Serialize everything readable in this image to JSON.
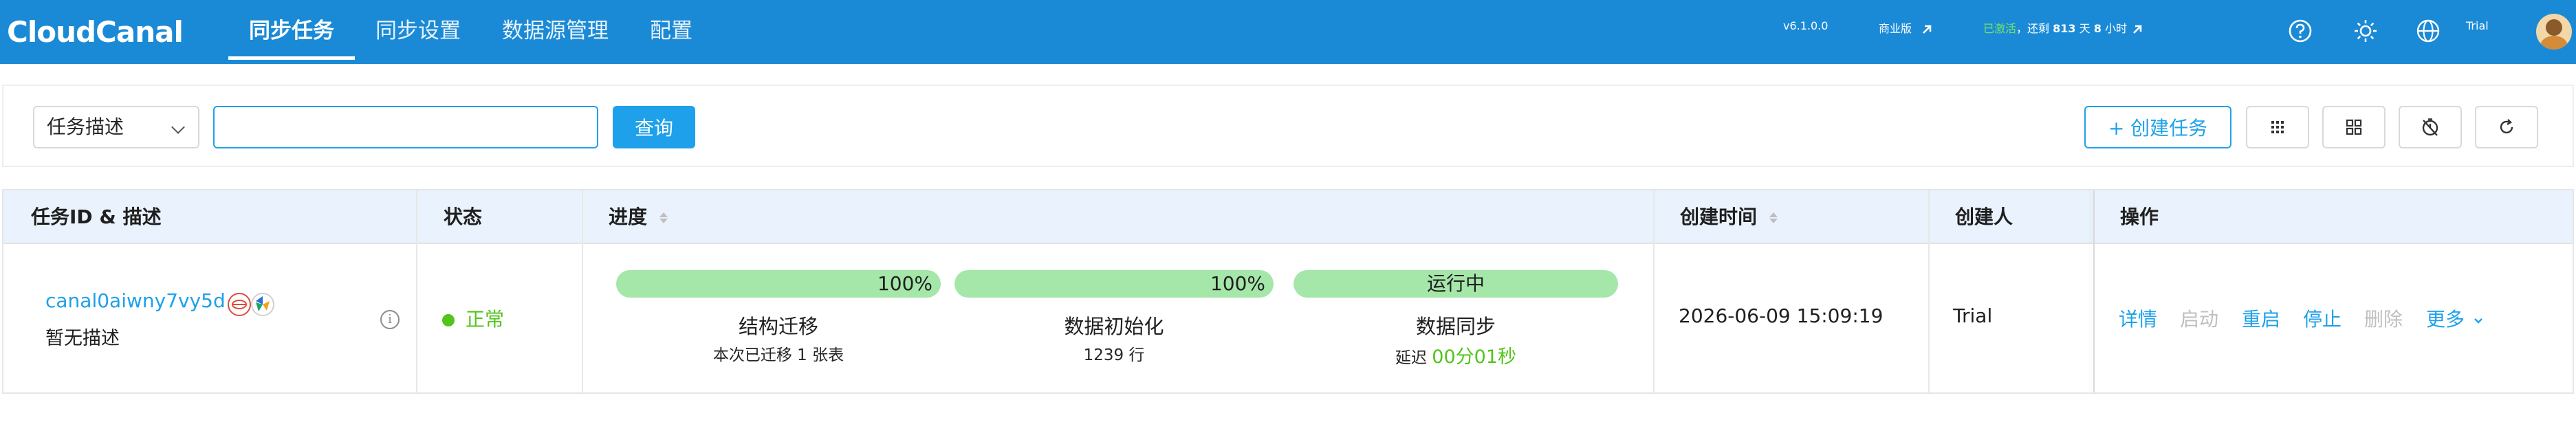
{
  "brand": {
    "logo_text": "CloudCanal"
  },
  "nav": {
    "items": [
      {
        "label": "同步任务",
        "active": true
      },
      {
        "label": "同步设置",
        "active": false
      },
      {
        "label": "数据源管理",
        "active": false
      },
      {
        "label": "配置",
        "active": false
      }
    ]
  },
  "header": {
    "version": "v6.1.0.0",
    "edition": "商业版",
    "activated": "已激活",
    "remaining_prefix": "，还剩",
    "days": "813",
    "days_unit": "天",
    "hours": "8",
    "hours_unit": "小时",
    "user": "Trial",
    "help_icon": "question-circle-icon",
    "theme_icon": "sun-icon",
    "lang_icon": "globe-icon"
  },
  "filter": {
    "select_value": "任务描述",
    "input_value": "",
    "input_placeholder": "",
    "query_label": "查询",
    "create_label": "+ 创建任务",
    "tools": [
      "grid-icon",
      "layout-icon",
      "timer-icon",
      "refresh-icon"
    ]
  },
  "table": {
    "columns": {
      "id_desc": "任务ID & 描述",
      "status": "状态",
      "progress": "进度",
      "created_at": "创建时间",
      "creator": "创建人",
      "actions": "操作"
    },
    "rows": [
      {
        "task_id": "canal0aiwny7vy5d",
        "description": "暂无描述",
        "status": "正常",
        "stages": [
          {
            "bar_text": "100%",
            "title": "结构迁移",
            "sub": "本次已迁移 1 张表",
            "progress": 100
          },
          {
            "bar_text": "100%",
            "title": "数据初始化",
            "sub": "1239 行",
            "progress": 100
          },
          {
            "bar_text": "运行中",
            "title": "数据同步",
            "sub_prefix": "延迟",
            "sub_value": "00分01秒",
            "progress": 100
          }
        ],
        "created_at": "2026-06-09 15:09:19",
        "creator": "Trial",
        "actions": {
          "detail": "详情",
          "start": "启动",
          "restart": "重启",
          "stop": "停止",
          "delete": "删除",
          "more": "更多"
        }
      }
    ]
  },
  "colors": {
    "topbar": "#1b8ad6",
    "accent": "#1ea1ea",
    "success": "#52c41a",
    "progress_fill": "#a5e6a9",
    "table_header": "#eaf3fd"
  }
}
